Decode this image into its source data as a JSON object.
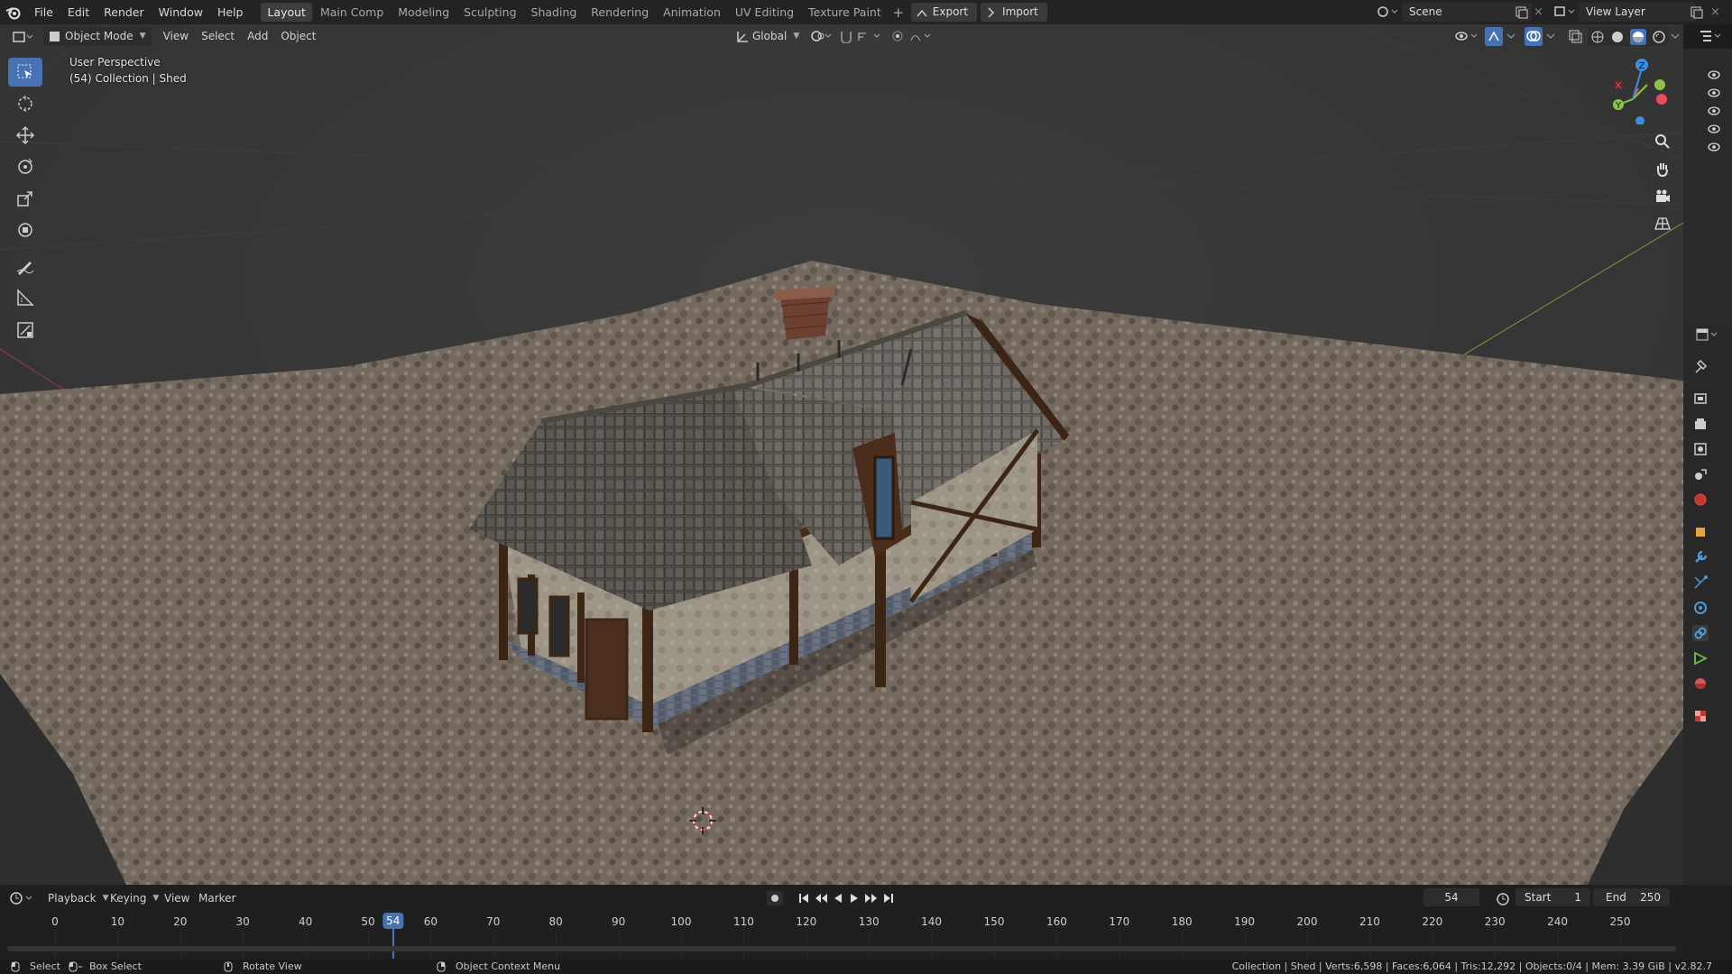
{
  "menubar": {
    "items": [
      "File",
      "Edit",
      "Render",
      "Window",
      "Help"
    ],
    "workspace_tabs": [
      "Layout",
      "Main Comp",
      "Modeling",
      "Sculpting",
      "Shading",
      "Rendering",
      "Animation",
      "UV Editing",
      "Texture Paint"
    ],
    "active_tab": "Layout",
    "add_tab": "+",
    "export_label": "Export",
    "import_label": "Import",
    "scene_name": "Scene",
    "view_layer_name": "View Layer"
  },
  "viewport_header": {
    "mode": "Object Mode",
    "menus": [
      "View",
      "Select",
      "Add",
      "Object"
    ],
    "orientation": "Global"
  },
  "viewport": {
    "perspective_label": "User Perspective",
    "collection_label": "(54) Collection | Shed",
    "gizmo_axes": {
      "x": "X",
      "y": "Y",
      "z": "Z"
    },
    "colors": {
      "x_axis": "#e84d5d",
      "y_axis": "#8bc34a",
      "z_axis": "#3b8ede",
      "select": "#4772b3"
    }
  },
  "toolbar": {
    "tools": [
      "select-box",
      "cursor",
      "move",
      "rotate",
      "scale",
      "transform",
      "annotate",
      "measure",
      "add-cube"
    ]
  },
  "timeline": {
    "menus": [
      "Playback",
      "Keying",
      "View",
      "Marker"
    ],
    "current_frame": "54",
    "start_label": "Start",
    "start_value": "1",
    "end_label": "End",
    "end_value": "250",
    "ruler_ticks": [
      "0",
      "10",
      "20",
      "30",
      "40",
      "50",
      "60",
      "70",
      "80",
      "90",
      "100",
      "110",
      "120",
      "130",
      "140",
      "150",
      "160",
      "170",
      "180",
      "190",
      "200",
      "210",
      "220",
      "230",
      "240",
      "250"
    ]
  },
  "statusbar": {
    "select": "Select",
    "box_select": "Box Select",
    "rotate_view": "Rotate View",
    "context_menu": "Object Context Menu",
    "stats": "Collection | Shed | Verts:6,598 | Faces:6,064 | Tris:12,292 | Objects:0/4 | Mem: 3.39 GiB | v2.82.7"
  }
}
